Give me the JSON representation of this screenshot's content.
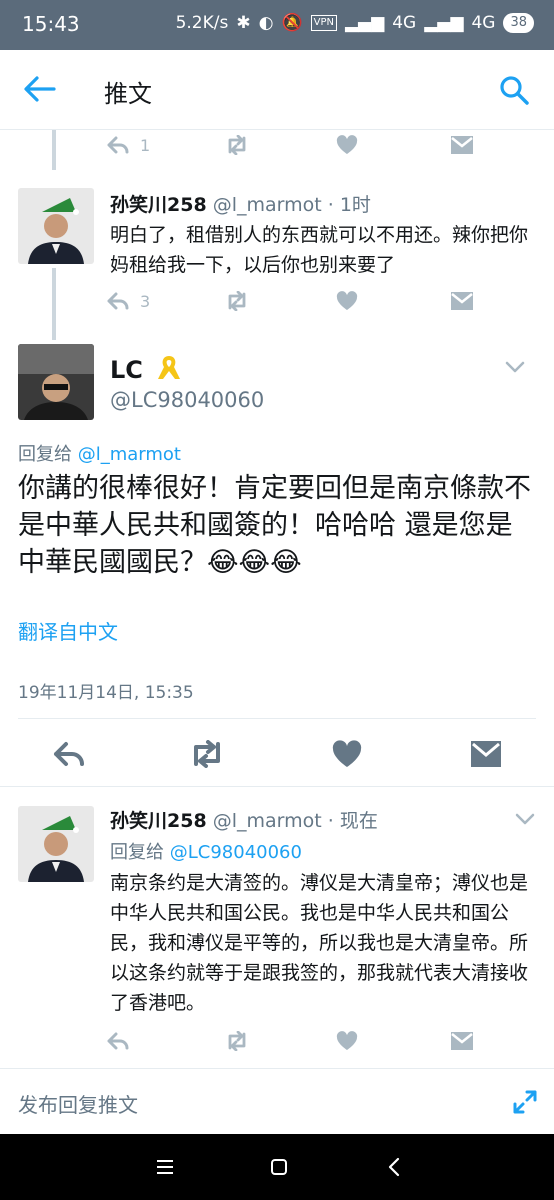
{
  "status_bar": {
    "time": "15:43",
    "speed": "5.2K/s",
    "vpn": "VPN",
    "net1": "4G",
    "net2": "4G",
    "battery": "38"
  },
  "app_bar": {
    "title": "推文"
  },
  "top_tweet_actions": {
    "reply_count": "1"
  },
  "tweet1": {
    "name": "孙笑川258",
    "handle": "@l_marmot",
    "time": "· 1时",
    "text": "明白了，租借别人的东西就可以不用还。辣你把你妈租给我一下，以后你也别来要了",
    "reply_count": "3"
  },
  "main_tweet": {
    "name": "LC",
    "handle": "@LC98040060",
    "reply_prefix": "回复给",
    "reply_to": "@l_marmot",
    "text": "你講的很棒很好！肯定要回但是南京條款不是中華人民共和國簽的！哈哈哈 還是您是中華民國國民？😂😂😂",
    "translate": "翻译自中文",
    "timestamp": "19年11月14日, 15:35"
  },
  "tweet2": {
    "name": "孙笑川258",
    "handle": "@l_marmot",
    "time": "· 现在",
    "reply_prefix": "回复给",
    "reply_to": "@LC98040060",
    "text": "南京条约是大清签的。溥仪是大清皇帝；溥仪也是中华人民共和国公民。我也是中华人民共和国公民，我和溥仪是平等的，所以我也是大清皇帝。所以这条约就等于是跟我签的，那我就代表大清接收了香港吧。"
  },
  "compose": {
    "placeholder": "发布回复推文"
  },
  "colors": {
    "accent": "#1da1f2",
    "muted": "#657786",
    "icon": "#aab8c2",
    "status_bar": "#5b6b7b"
  }
}
